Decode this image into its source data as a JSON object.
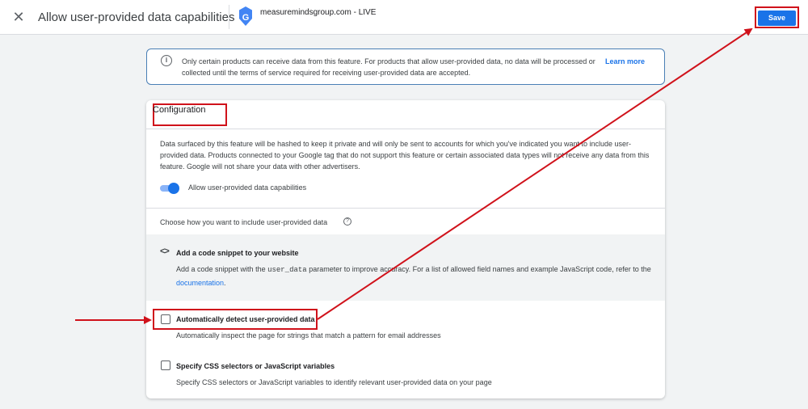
{
  "header": {
    "title": "Allow user-provided data capabilities",
    "property_name": "measuremindsgroup.com - LIVE",
    "save_label": "Save"
  },
  "notice": {
    "text": "Only certain products can receive data from this feature. For products that allow user-provided data, no data will be processed or collected until the terms of service required for receiving user-provided data are accepted.",
    "link_label": "Learn more"
  },
  "configuration": {
    "title": "Configuration",
    "description": "Data surfaced by this feature will be hashed to keep it private and will only be sent to accounts for which you've indicated you want to include user-provided data. Products connected to your Google tag that do not support this feature or certain associated data types will not receive any data from this feature. Google will not share your data with other advertisers.",
    "toggle": {
      "label": "Allow user-provided data capabilities",
      "on": true
    },
    "choose_label": "Choose how you want to include user-provided data",
    "code_snippet": {
      "icon": "code-icon",
      "title": "Add a code snippet to your website",
      "desc_before": "Add a code snippet with the ",
      "desc_code": "user_data",
      "desc_middle": " parameter to improve accuracy. For a list of allowed field names and example JavaScript code, refer to the ",
      "desc_link": "documentation",
      "desc_after": "."
    },
    "options": [
      {
        "title": "Automatically detect user-provided data",
        "description": "Automatically inspect the page for strings that match a pattern for email addresses",
        "checked": false
      },
      {
        "title": "Specify CSS selectors or JavaScript variables",
        "description": "Specify CSS selectors or JavaScript variables to identify relevant user-provided data on your page",
        "checked": false
      }
    ]
  },
  "colors": {
    "primary": "#1a73e8",
    "annotation_red": "#d0121b",
    "background": "#f1f3f4"
  }
}
